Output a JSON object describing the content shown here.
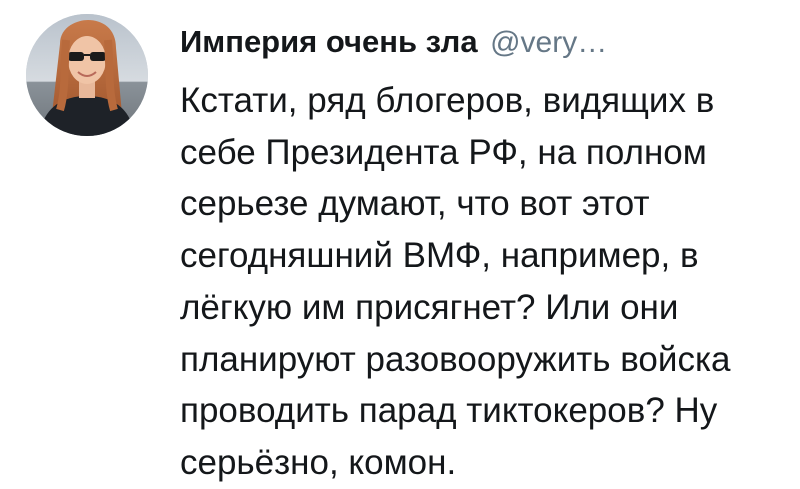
{
  "tweet": {
    "author": {
      "display_name": "Империя очень зла",
      "handle": "@very…"
    },
    "text_lines": [
      "Кстати, ряд блогеров, видящих в",
      "себе Президента РФ, на полном",
      "серьезе думают, что вот этот",
      "сегодняшний ВМФ, например, в",
      "лёгкую им присягнет? Или они",
      "планируют разовооружить войска",
      "проводить парад тиктокеров? Ну",
      "серьёзно, комон."
    ]
  },
  "colors": {
    "text": "#14171a",
    "secondary_text": "#657786",
    "background": "#ffffff"
  },
  "icons": {
    "avatar": "profile-photo"
  }
}
